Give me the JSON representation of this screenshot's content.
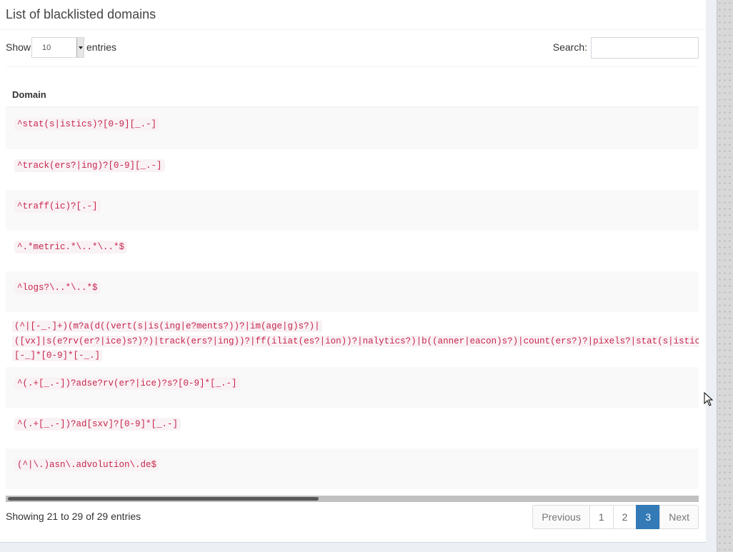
{
  "box": {
    "title": "List of blacklisted domains"
  },
  "controls": {
    "show_label": "Show",
    "length_value": "10",
    "entries_label": "entries",
    "search_label": "Search:",
    "search_value": ""
  },
  "table": {
    "header": "Domain",
    "rows": [
      "^stat(s|istics)?[0-9][_.-]",
      "^track(ers?|ing)?[0-9][_.-]",
      "^traff(ic)?[.-]",
      "^.*metric.*\\..*\\..*$",
      "^logs?\\..*\\..*$",
      "(^|[-_.]+)(m?a(d((vert(s|is(ing|e?ments?))?|im(age|g)s?)|",
      "^(.+[_.-])?adse?rv(er?|ice)?s?[0-9]*[_.-]",
      "^(.+[_.-])?ad[sxv]?[0-9]*[_.-]",
      "(^|\\.)asn\\.advolution\\.de$"
    ],
    "long_row_lines": [
      "(^|[-_.]+)(m?a(d((vert(s|is(ing|e?ments?))?|im(age|g)s?)|",
      "([vx]|s(e?rv(er?|ice)s?)?)|track(ers?|ing))?|ff(iliat(es?|ion))?|nalytics?)|b((anner|eacon)s?)|count(ers?)?|pixels?|stat(s|istics)?)",
      "[-_]*[0-9]*[-_.]"
    ]
  },
  "footer": {
    "info": "Showing 21 to 29 of 29 entries",
    "pagination": [
      "Previous",
      "1",
      "2",
      "3",
      "Next"
    ],
    "active_page": "3"
  }
}
